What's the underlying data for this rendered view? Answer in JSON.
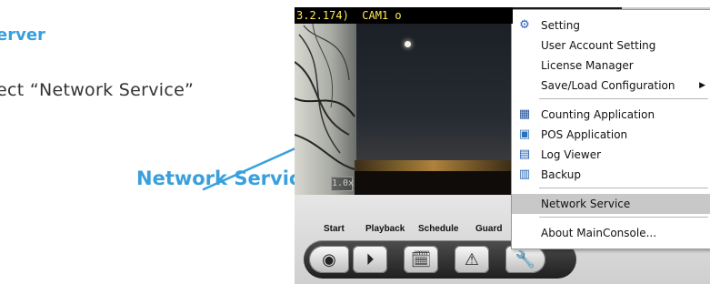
{
  "annotation": {
    "heading": "erver",
    "instruction": "ect “Network Service”",
    "callout": "Network Service",
    "accent_color": "#3aa0dc"
  },
  "camera": {
    "title": "3.2.174)  CAM1 o",
    "zoom": "1.0x"
  },
  "toolbar": {
    "labels": [
      "Start",
      "Playback",
      "Schedule",
      "Guard"
    ],
    "buttons": [
      {
        "icon": "record-icon",
        "glyph": "◉"
      },
      {
        "icon": "playback-icon",
        "glyph": "⏵"
      },
      {
        "icon": "schedule-icon",
        "glyph": "🗓"
      },
      {
        "icon": "guard-icon",
        "glyph": "⚠"
      },
      {
        "icon": "tools-icon",
        "glyph": "🔧"
      }
    ]
  },
  "menu": {
    "items": [
      {
        "label": "Setting",
        "icon": "setting-icon",
        "glyph": "⚙"
      },
      {
        "label": "User Account Setting"
      },
      {
        "label": "License Manager"
      },
      {
        "label": "Save/Load Configuration",
        "submenu": true
      },
      {
        "label": "Counting Application",
        "icon": "counting-icon",
        "glyph": "▦"
      },
      {
        "label": "POS Application",
        "icon": "pos-icon",
        "glyph": "▣"
      },
      {
        "label": "Log Viewer",
        "icon": "log-icon",
        "glyph": "▤"
      },
      {
        "label": "Backup",
        "icon": "backup-icon",
        "glyph": "▥"
      },
      {
        "label": "Network Service",
        "highlighted": true
      },
      {
        "label": "About MainConsole..."
      }
    ]
  }
}
